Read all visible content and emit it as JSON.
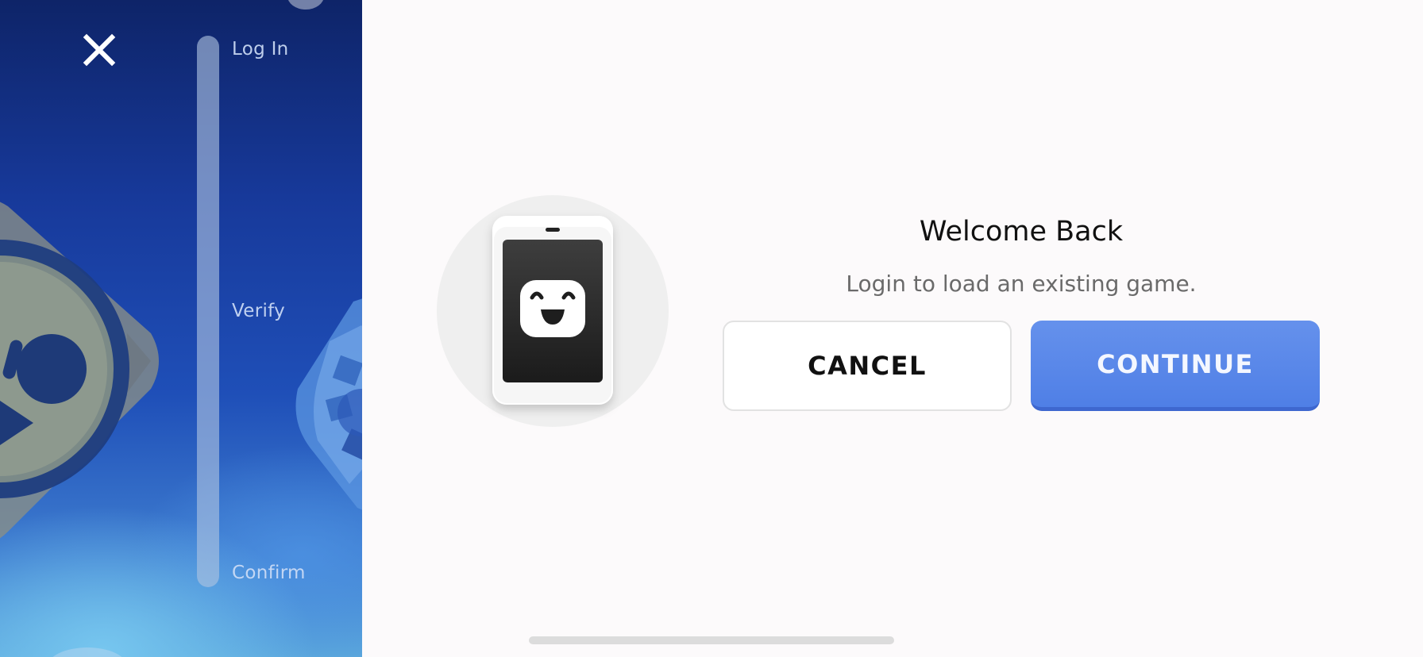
{
  "sidebar": {
    "close_icon": "close-icon",
    "steps": [
      {
        "label": "Log In"
      },
      {
        "label": "Verify"
      },
      {
        "label": "Confirm"
      }
    ]
  },
  "dialog": {
    "illustration_icon": "smiling-phone-icon",
    "title": "Welcome Back",
    "subtitle": "Login to load an existing game.",
    "cancel_label": "CANCEL",
    "continue_label": "CONTINUE"
  },
  "colors": {
    "accent": "#5585e8",
    "left_panel_dark": "#0e2468",
    "left_panel_light": "#5aa6dc",
    "background": "#fcfafb"
  }
}
